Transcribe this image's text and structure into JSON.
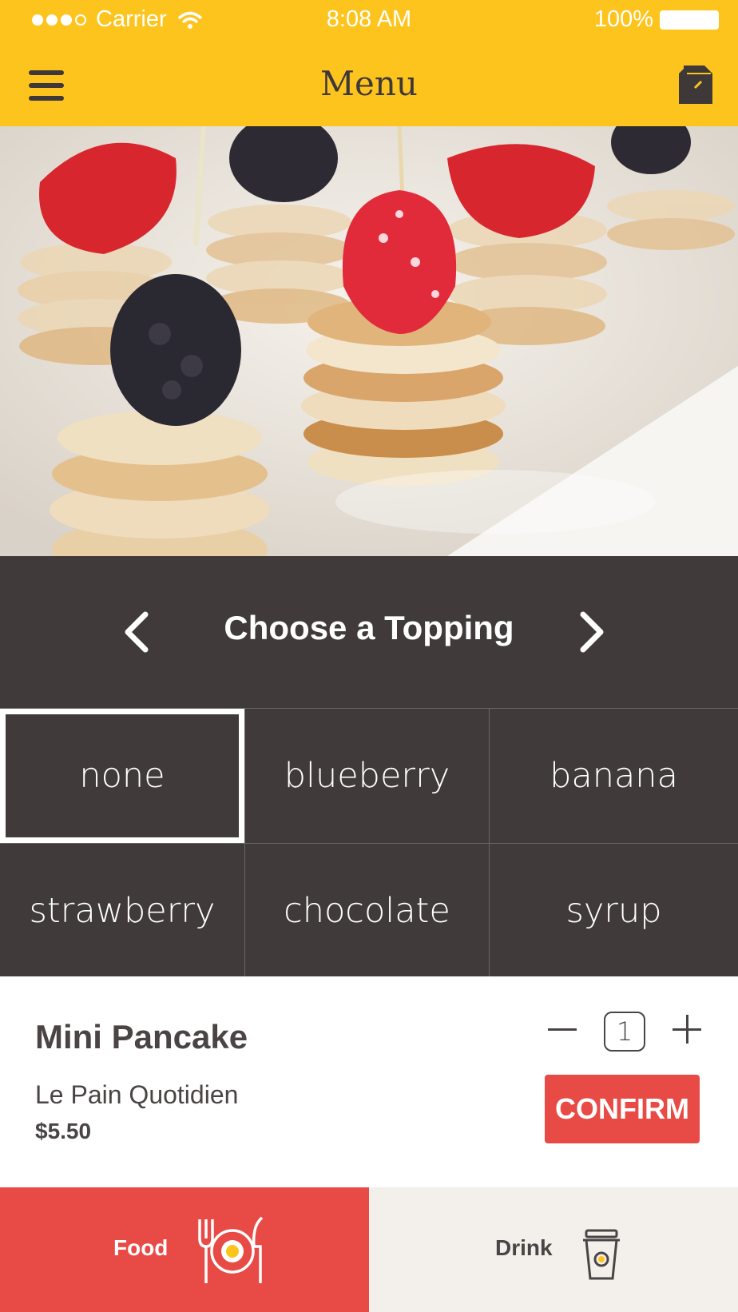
{
  "status_bar": {
    "carrier": "Carrier",
    "time": "8:08 AM",
    "battery": "100%"
  },
  "header": {
    "title": "Menu"
  },
  "topping": {
    "title": "Choose a Topping",
    "options": [
      "none",
      "blueberry",
      "banana",
      "strawberry",
      "chocolate",
      "syrup"
    ],
    "selected": "none"
  },
  "product": {
    "name": "Mini Pancake",
    "vendor": "Le Pain Quotidien",
    "price": "$5.50",
    "quantity": "1",
    "confirm_label": "CONFIRM"
  },
  "tabs": {
    "food": "Food",
    "drink": "Drink"
  },
  "colors": {
    "header_bg": "#fec41e",
    "panel_bg": "#403a3a",
    "accent_red": "#e84a45",
    "text_dark": "#4a4444",
    "drink_tab_bg": "#f3f0eb"
  }
}
